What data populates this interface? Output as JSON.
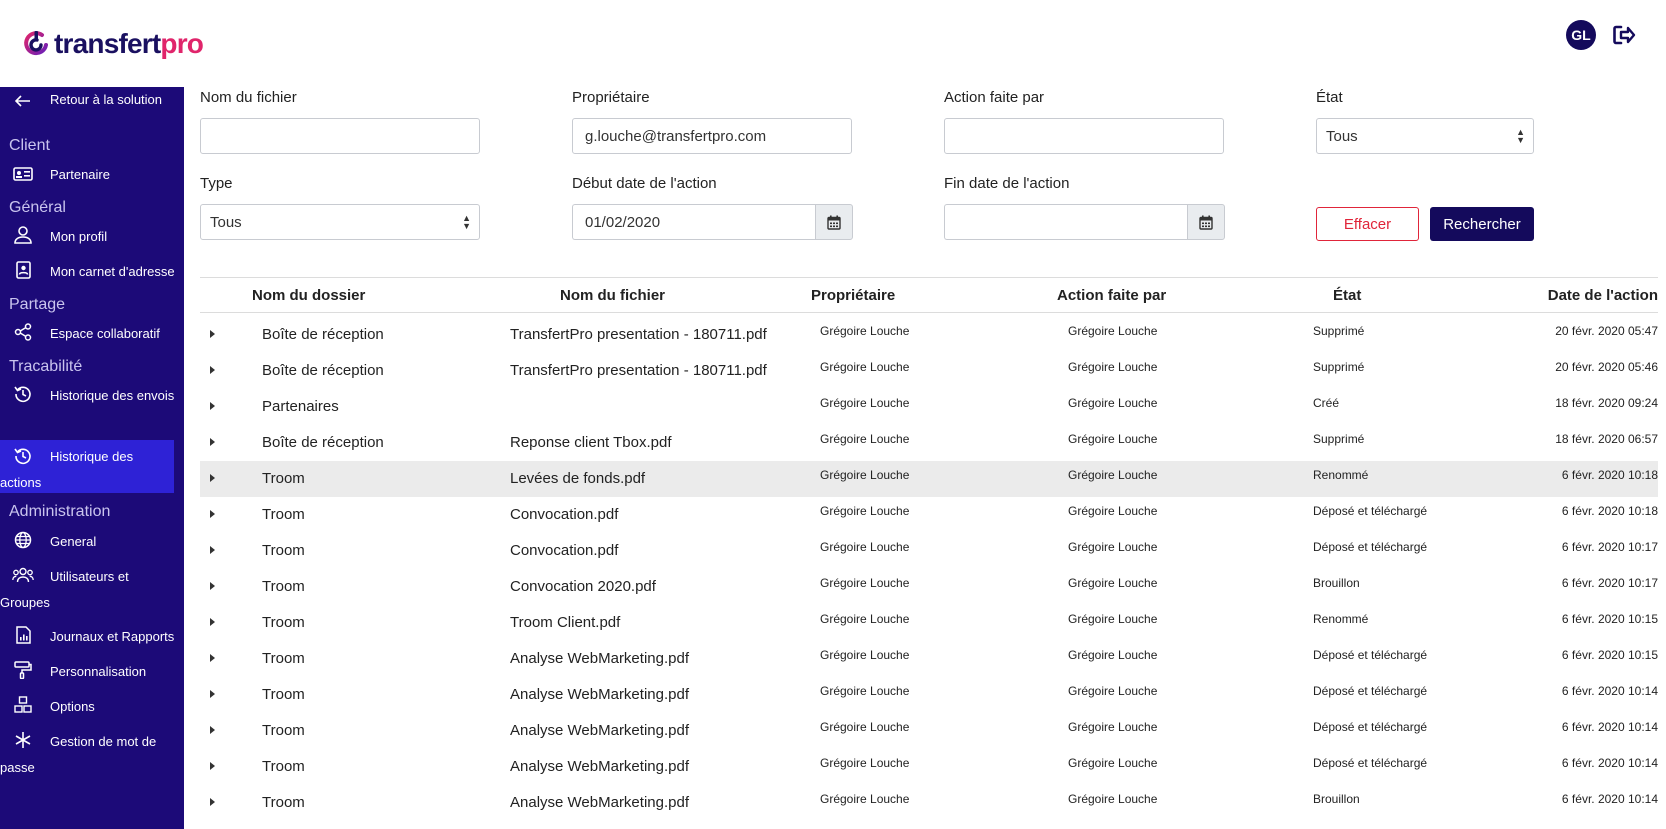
{
  "brand": {
    "name_part1": "transfert",
    "name_part2": "pro",
    "accent": "#e0256b",
    "primary": "#1c0a78"
  },
  "user": {
    "initials": "GL"
  },
  "sidebar": {
    "back_label": "Retour à la solution",
    "sections": {
      "client": "Client",
      "general": "Général",
      "partage": "Partage",
      "tracabilite": "Tracabilité",
      "administration": "Administration"
    },
    "items": {
      "partenaire": "Partenaire",
      "mon_profil": "Mon profil",
      "carnet": "Mon carnet d'adresse",
      "espace": "Espace collaboratif",
      "hist_envois": "Historique des envois",
      "hist_actions_1": "Historique des",
      "hist_actions_2": "actions",
      "general": "General",
      "users_1": "Utilisateurs et",
      "users_2": "Groupes",
      "journaux": "Journaux et Rapports",
      "perso": "Personnalisation",
      "options": "Options",
      "mdp_1": "Gestion de mot de",
      "mdp_2": "passe"
    }
  },
  "filters": {
    "file_name_label": "Nom du fichier",
    "file_name_value": "",
    "owner_label": "Propriétaire",
    "owner_value": "g.louche@transfertpro.com",
    "action_by_label": "Action faite par",
    "action_by_value": "",
    "state_label": "État",
    "state_value": "Tous",
    "type_label": "Type",
    "type_value": "Tous",
    "start_label": "Début date de l'action",
    "start_value": "01/02/2020",
    "end_label": "Fin date de l'action",
    "end_value": "",
    "clear_label": "Effacer",
    "search_label": "Rechercher"
  },
  "table": {
    "headers": [
      "Nom du dossier",
      "Nom du fichier",
      "Propriétaire",
      "Action faite par",
      "État",
      "Date de l'action"
    ],
    "rows": [
      {
        "folder": "Boîte de réception",
        "file": "TransfertPro presentation - 180711.pdf",
        "owner": "Grégoire Louche",
        "by": "Grégoire Louche",
        "state": "Supprimé",
        "date": "20 févr. 2020 05:47"
      },
      {
        "folder": "Boîte de réception",
        "file": "TransfertPro presentation - 180711.pdf",
        "owner": "Grégoire Louche",
        "by": "Grégoire Louche",
        "state": "Supprimé",
        "date": "20 févr. 2020 05:46"
      },
      {
        "folder": "Partenaires",
        "file": "",
        "owner": "Grégoire Louche",
        "by": "Grégoire Louche",
        "state": "Créé",
        "date": "18 févr. 2020 09:24"
      },
      {
        "folder": "Boîte de réception",
        "file": "Reponse client Tbox.pdf",
        "owner": "Grégoire Louche",
        "by": "Grégoire Louche",
        "state": "Supprimé",
        "date": "18 févr. 2020 06:57"
      },
      {
        "folder": "Troom",
        "file": "Levées de fonds.pdf",
        "owner": "Grégoire Louche",
        "by": "Grégoire Louche",
        "state": "Renommé",
        "date": "6 févr. 2020 10:18"
      },
      {
        "folder": "Troom",
        "file": "Convocation.pdf",
        "owner": "Grégoire Louche",
        "by": "Grégoire Louche",
        "state": "Déposé et téléchargé",
        "date": "6 févr. 2020 10:18"
      },
      {
        "folder": "Troom",
        "file": "Convocation.pdf",
        "owner": "Grégoire Louche",
        "by": "Grégoire Louche",
        "state": "Déposé et téléchargé",
        "date": "6 févr. 2020 10:17"
      },
      {
        "folder": "Troom",
        "file": "Convocation 2020.pdf",
        "owner": "Grégoire Louche",
        "by": "Grégoire Louche",
        "state": "Brouillon",
        "date": "6 févr. 2020 10:17"
      },
      {
        "folder": "Troom",
        "file": "Troom Client.pdf",
        "owner": "Grégoire Louche",
        "by": "Grégoire Louche",
        "state": "Renommé",
        "date": "6 févr. 2020 10:15"
      },
      {
        "folder": "Troom",
        "file": "Analyse WebMarketing.pdf",
        "owner": "Grégoire Louche",
        "by": "Grégoire Louche",
        "state": "Déposé et téléchargé",
        "date": "6 févr. 2020 10:15"
      },
      {
        "folder": "Troom",
        "file": "Analyse WebMarketing.pdf",
        "owner": "Grégoire Louche",
        "by": "Grégoire Louche",
        "state": "Déposé et téléchargé",
        "date": "6 févr. 2020 10:14"
      },
      {
        "folder": "Troom",
        "file": "Analyse WebMarketing.pdf",
        "owner": "Grégoire Louche",
        "by": "Grégoire Louche",
        "state": "Déposé et téléchargé",
        "date": "6 févr. 2020 10:14"
      },
      {
        "folder": "Troom",
        "file": "Analyse WebMarketing.pdf",
        "owner": "Grégoire Louche",
        "by": "Grégoire Louche",
        "state": "Déposé et téléchargé",
        "date": "6 févr. 2020 10:14"
      },
      {
        "folder": "Troom",
        "file": "Analyse WebMarketing.pdf",
        "owner": "Grégoire Louche",
        "by": "Grégoire Louche",
        "state": "Brouillon",
        "date": "6 févr. 2020 10:14"
      }
    ]
  }
}
